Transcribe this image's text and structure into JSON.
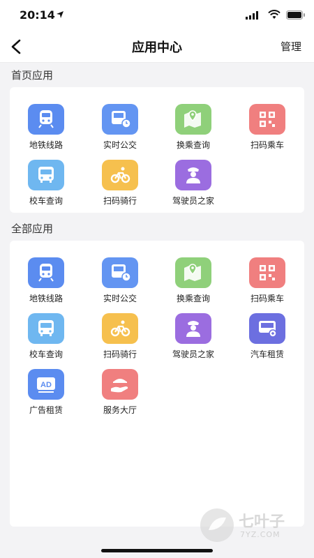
{
  "status_bar": {
    "time": "20:14"
  },
  "nav": {
    "title": "应用中心",
    "manage_label": "管理"
  },
  "home_section": {
    "title": "首页应用",
    "apps": [
      {
        "label": "地铁线路",
        "icon": "subway-icon",
        "color": "#5b8cf0"
      },
      {
        "label": "实时公交",
        "icon": "bus-clock-icon",
        "color": "#6395f2"
      },
      {
        "label": "换乘查询",
        "icon": "map-pin-icon",
        "color": "#8fd07a"
      },
      {
        "label": "扫码乘车",
        "icon": "qr-code-icon",
        "color": "#f07f7f"
      },
      {
        "label": "校车查询",
        "icon": "school-bus-icon",
        "color": "#6fb7f0"
      },
      {
        "label": "扫码骑行",
        "icon": "bicycle-icon",
        "color": "#f6c04e"
      },
      {
        "label": "驾驶员之家",
        "icon": "driver-icon",
        "color": "#9b6de0"
      }
    ]
  },
  "all_section": {
    "title": "全部应用",
    "apps": [
      {
        "label": "地铁线路",
        "icon": "subway-icon",
        "color": "#5b8cf0"
      },
      {
        "label": "实时公交",
        "icon": "bus-clock-icon",
        "color": "#6395f2"
      },
      {
        "label": "换乘查询",
        "icon": "map-pin-icon",
        "color": "#8fd07a"
      },
      {
        "label": "扫码乘车",
        "icon": "qr-code-icon",
        "color": "#f07f7f"
      },
      {
        "label": "校车查询",
        "icon": "school-bus-icon",
        "color": "#6fb7f0"
      },
      {
        "label": "扫码骑行",
        "icon": "bicycle-icon",
        "color": "#f6c04e"
      },
      {
        "label": "驾驶员之家",
        "icon": "driver-icon",
        "color": "#9b6de0"
      },
      {
        "label": "汽车租赁",
        "icon": "car-rental-icon",
        "color": "#6c6fe0"
      },
      {
        "label": "广告租赁",
        "icon": "ad-icon",
        "color": "#5b8cf0"
      },
      {
        "label": "服务大厅",
        "icon": "service-hand-icon",
        "color": "#f07f7f"
      }
    ]
  },
  "watermark": {
    "text": "七叶子",
    "sub": "7YZ.COM"
  }
}
